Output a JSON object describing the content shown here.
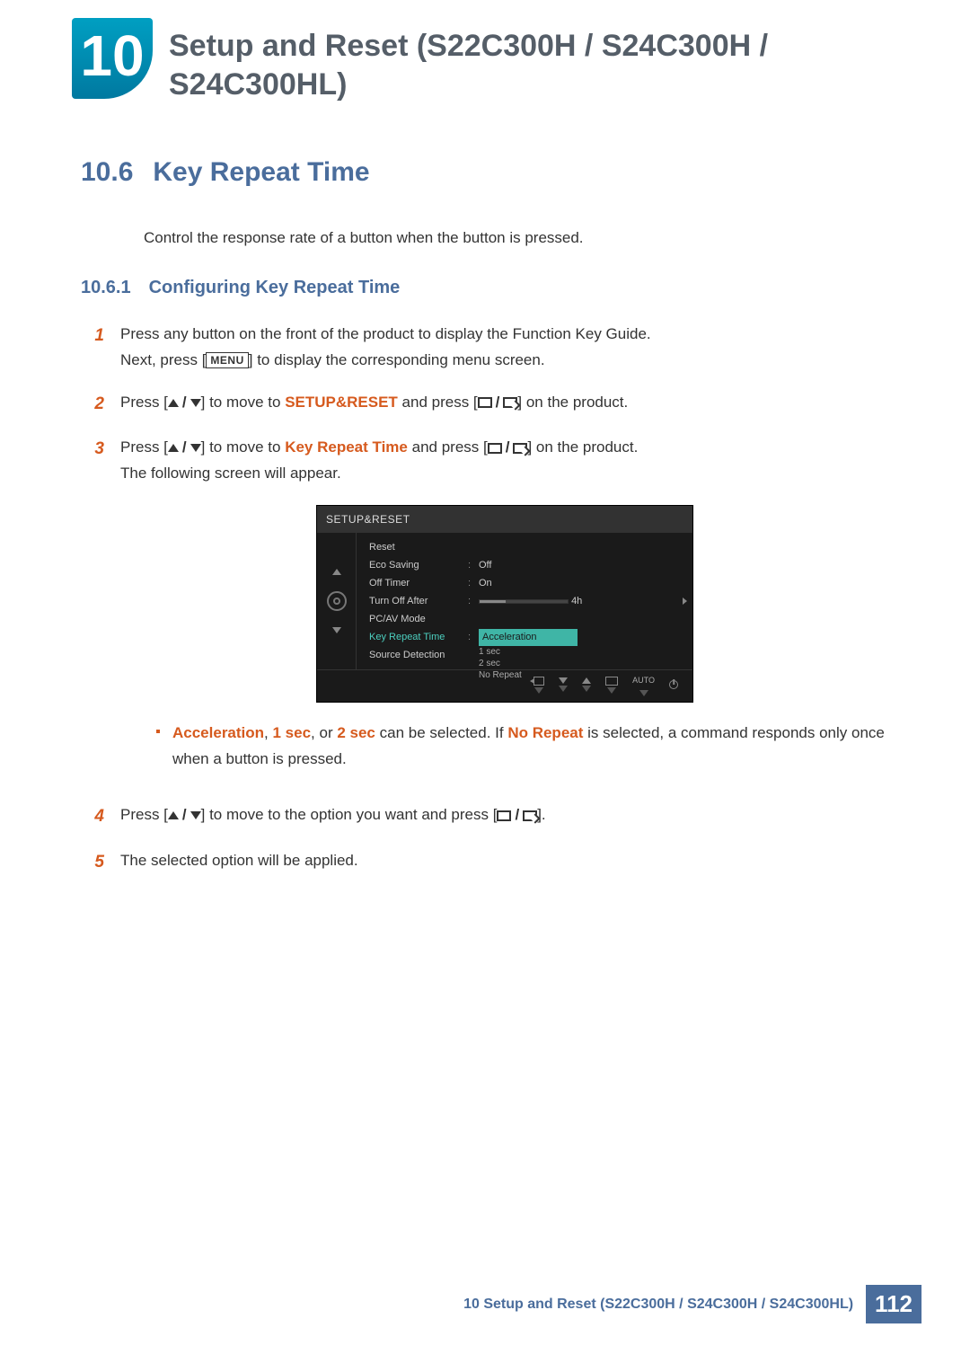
{
  "header": {
    "chapter_number": "10",
    "chapter_title": "Setup and Reset (S22C300H / S24C300H / S24C300HL)"
  },
  "section": {
    "number": "10.6",
    "title": "Key Repeat Time",
    "description": "Control the response rate of a button when the button is pressed."
  },
  "subsection": {
    "number": "10.6.1",
    "title": "Configuring Key Repeat Time"
  },
  "steps": {
    "s1_num": "1",
    "s1a": "Press any button on the front of the product to display the Function Key Guide.",
    "s1b_pre": "Next, press [",
    "s1b_menu": "MENU",
    "s1b_post": "] to display the corresponding menu screen.",
    "s2_num": "2",
    "s2_pre": "Press [",
    "s2_mid": "] to move to ",
    "s2_target": "SETUP&RESET",
    "s2_post1": " and press [",
    "s2_post2": "] on the product.",
    "s3_num": "3",
    "s3_pre": "Press [",
    "s3_mid": "] to move to ",
    "s3_target": "Key Repeat Time",
    "s3_post1": " and press [",
    "s3_post2": "] on the product.",
    "s3_follow": "The following screen will appear.",
    "s4_num": "4",
    "s4_pre": "Press [",
    "s4_mid": "] to move to the option you want and press [",
    "s4_post": "].",
    "s5_num": "5",
    "s5_text": "The selected option will be applied."
  },
  "note": {
    "w1": "Acceleration",
    "t1": ", ",
    "w2": "1 sec",
    "t2": ", or ",
    "w3": "2 sec",
    "t3": " can be selected. If ",
    "w4": "No Repeat",
    "t4": " is selected, a command responds only once when a button is pressed."
  },
  "osd": {
    "title": "SETUP&RESET",
    "rows": {
      "reset": "Reset",
      "eco": "Eco Saving",
      "eco_val": "Off",
      "offtimer": "Off Timer",
      "offtimer_val": "On",
      "turnoff": "Turn Off After",
      "turnoff_val": "4h",
      "pcav": "PC/AV Mode",
      "krt": "Key Repeat Time",
      "krt_val": "Acceleration",
      "source": "Source Detection"
    },
    "options": {
      "o1": "1 sec",
      "o2": "2 sec",
      "o3": "No Repeat"
    },
    "footer": {
      "auto": "AUTO"
    }
  },
  "footer": {
    "text": "10 Setup and Reset (S22C300H / S24C300H / S24C300HL)",
    "page": "112"
  }
}
